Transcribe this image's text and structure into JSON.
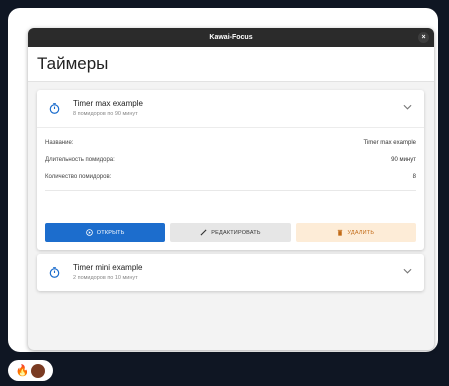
{
  "window": {
    "title": "Kawai-Focus",
    "close_glyph": "×"
  },
  "page": {
    "title": "Таймеры"
  },
  "timers": [
    {
      "name": "Timer max example",
      "summary": "8 помидоров по 90 минут",
      "details": [
        {
          "label": "Название:",
          "value": "Timer max example"
        },
        {
          "label": "Длительность помидора:",
          "value": "90 минут"
        },
        {
          "label": "Количество помидоров:",
          "value": "8"
        }
      ],
      "actions": {
        "open": "ОТКРЫТЬ",
        "edit": "РЕДАКТИРОВАТЬ",
        "delete": "УДАЛИТЬ"
      }
    },
    {
      "name": "Timer mini example",
      "summary": "2 помидоров по 10 минут"
    }
  ],
  "reactions": {
    "emoji": "🔥"
  },
  "colors": {
    "accent": "#1c6dcd",
    "danger_bg": "#fdecd7",
    "danger_text": "#c26a16"
  }
}
